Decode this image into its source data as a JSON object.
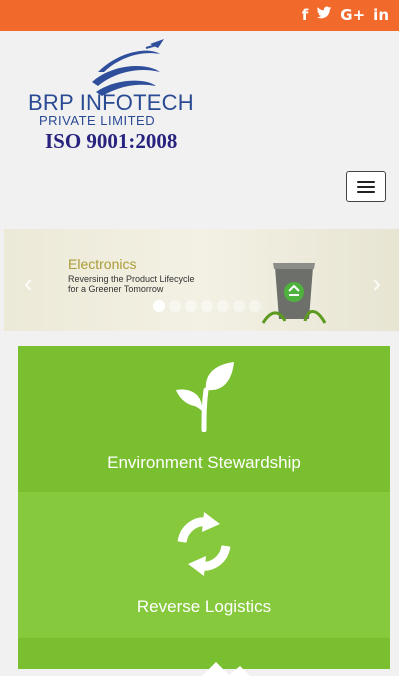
{
  "header": {
    "social": [
      "f",
      "🐦",
      "G+",
      "in"
    ]
  },
  "logo": {
    "brand": "BRP INFOTECH",
    "subtitle": "PRIVATE LIMITED",
    "iso": "ISO 9001:2008"
  },
  "menu": {
    "icon": "hamburger-icon"
  },
  "slider": {
    "title": "Electronics",
    "subtitle_line1": "Reversing the Product Lifecycle",
    "subtitle_line2": "for a Greener Tomorrow",
    "arrow_left": "‹",
    "arrow_right": "›",
    "dots_total": 7,
    "active_dot": 1
  },
  "panels": [
    {
      "label": "Environment Stewardship",
      "icon": "leaf-icon"
    },
    {
      "label": "Reverse Logistics",
      "icon": "recycle-icon"
    },
    {
      "label": "",
      "icon": "arrow-up-icon"
    }
  ],
  "colors": {
    "topbar": "#f26a2b",
    "panel_green": "#7abf2f",
    "brand_blue": "#2a4a93"
  }
}
